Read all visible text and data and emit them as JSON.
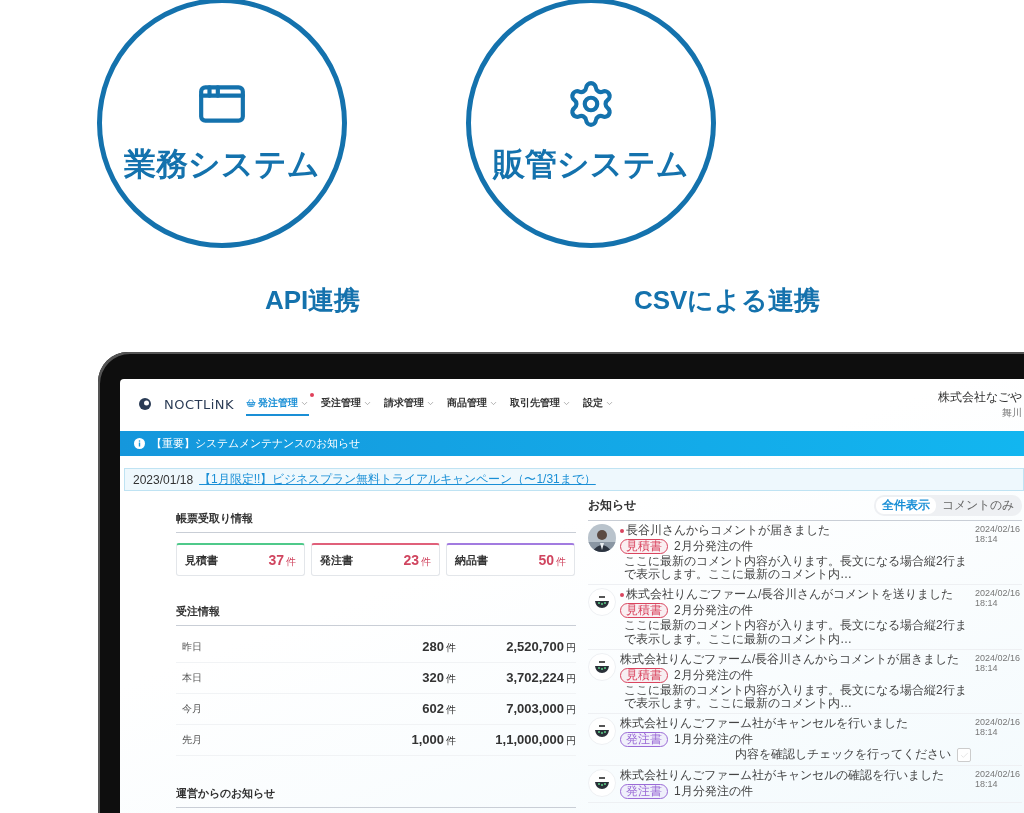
{
  "systems": [
    {
      "kind": "window",
      "name": "業務システム",
      "link": "API連携"
    },
    {
      "kind": "gear",
      "name": "販管システム",
      "link": "CSVによる連携"
    }
  ],
  "header": {
    "logo": "NOCTLiNK",
    "nav": [
      {
        "label": "発注管理",
        "selected": true,
        "alert": true
      },
      {
        "label": "受注管理",
        "selected": false,
        "alert": false
      },
      {
        "label": "請求管理",
        "selected": false,
        "alert": false
      },
      {
        "label": "商品管理",
        "selected": false,
        "alert": false
      },
      {
        "label": "取引先管理",
        "selected": false,
        "alert": false
      },
      {
        "label": "設定",
        "selected": false,
        "alert": false
      }
    ],
    "company": "株式会社なごや",
    "user": "舞川"
  },
  "banner": "【重要】システムメンテナンスのお知らせ",
  "news": {
    "date": "2023/01/18",
    "link": "【1月限定!!】ビジネスプラン無料トライアルキャンペーン（〜1/31まで）"
  },
  "documents": {
    "title": "帳票受取り情報",
    "cards": [
      {
        "label": "見積書",
        "count": "37",
        "unit": "件",
        "color": "#4fc98a"
      },
      {
        "label": "発注書",
        "count": "23",
        "unit": "件",
        "color": "#e0607a"
      },
      {
        "label": "納品書",
        "count": "50",
        "unit": "件",
        "color": "#a27be0"
      }
    ]
  },
  "orders": {
    "title": "受注情報",
    "rows": [
      {
        "label": "昨日",
        "count": "280",
        "count_unit": "件",
        "amount": "2,520,700",
        "amount_unit": "円"
      },
      {
        "label": "本日",
        "count": "320",
        "count_unit": "件",
        "amount": "3,702,224",
        "amount_unit": "円"
      },
      {
        "label": "今月",
        "count": "602",
        "count_unit": "件",
        "amount": "7,003,000",
        "amount_unit": "円"
      },
      {
        "label": "先月",
        "count": "1,000",
        "count_unit": "件",
        "amount": "1,1,000,000",
        "amount_unit": "円"
      }
    ]
  },
  "operations": {
    "title": "運営からのお知らせ"
  },
  "notices": {
    "title": "お知らせ",
    "filters": [
      {
        "label": "全件表示",
        "selected": true
      },
      {
        "label": "コメントのみ",
        "selected": false
      }
    ],
    "items": [
      {
        "kind": "person",
        "unread": true,
        "title": "長谷川さんからコメントが届きました",
        "tag": "見積書",
        "color": "#d9455f",
        "subject": "2月分発注の件",
        "body": "ここに最新のコメント内容が入ります。長文になる場合縦2行まで表示します。ここに最新のコメント内…",
        "date": "2024/02/16",
        "time": "18:14"
      },
      {
        "kind": "logo",
        "unread": true,
        "title": "株式会社りんごファーム/長谷川さんがコメントを送りました",
        "tag": "見積書",
        "color": "#d9455f",
        "subject": "2月分発注の件",
        "body": "ここに最新のコメント内容が入ります。長文になる場合縦2行まで表示します。ここに最新のコメント内…",
        "date": "2024/02/16",
        "time": "18:14"
      },
      {
        "kind": "logo",
        "unread": false,
        "title": "株式会社りんごファーム/長谷川さんからコメントが届きました",
        "tag": "見積書",
        "color": "#d9455f",
        "subject": "2月分発注の件",
        "body": "ここに最新のコメント内容が入ります。長文になる場合縦2行まで表示します。ここに最新のコメント内…",
        "date": "2024/02/16",
        "time": "18:14"
      },
      {
        "kind": "logo",
        "unread": false,
        "title": "株式会社りんごファーム社がキャンセルを行いました",
        "tag": "発注書",
        "color": "#9b6bd6",
        "subject": "1月分発注の件",
        "check": {
          "label": "内容を確認しチェックを行ってください",
          "checked": false
        },
        "date": "2024/02/16",
        "time": "18:14"
      },
      {
        "kind": "logo",
        "unread": false,
        "title": "株式会社りんごファーム社がキャンセルの確認を行いました",
        "tag": "発注書",
        "color": "#9b6bd6",
        "subject": "1月分発注の件",
        "date": "2024/02/16",
        "time": "18:14"
      }
    ]
  }
}
